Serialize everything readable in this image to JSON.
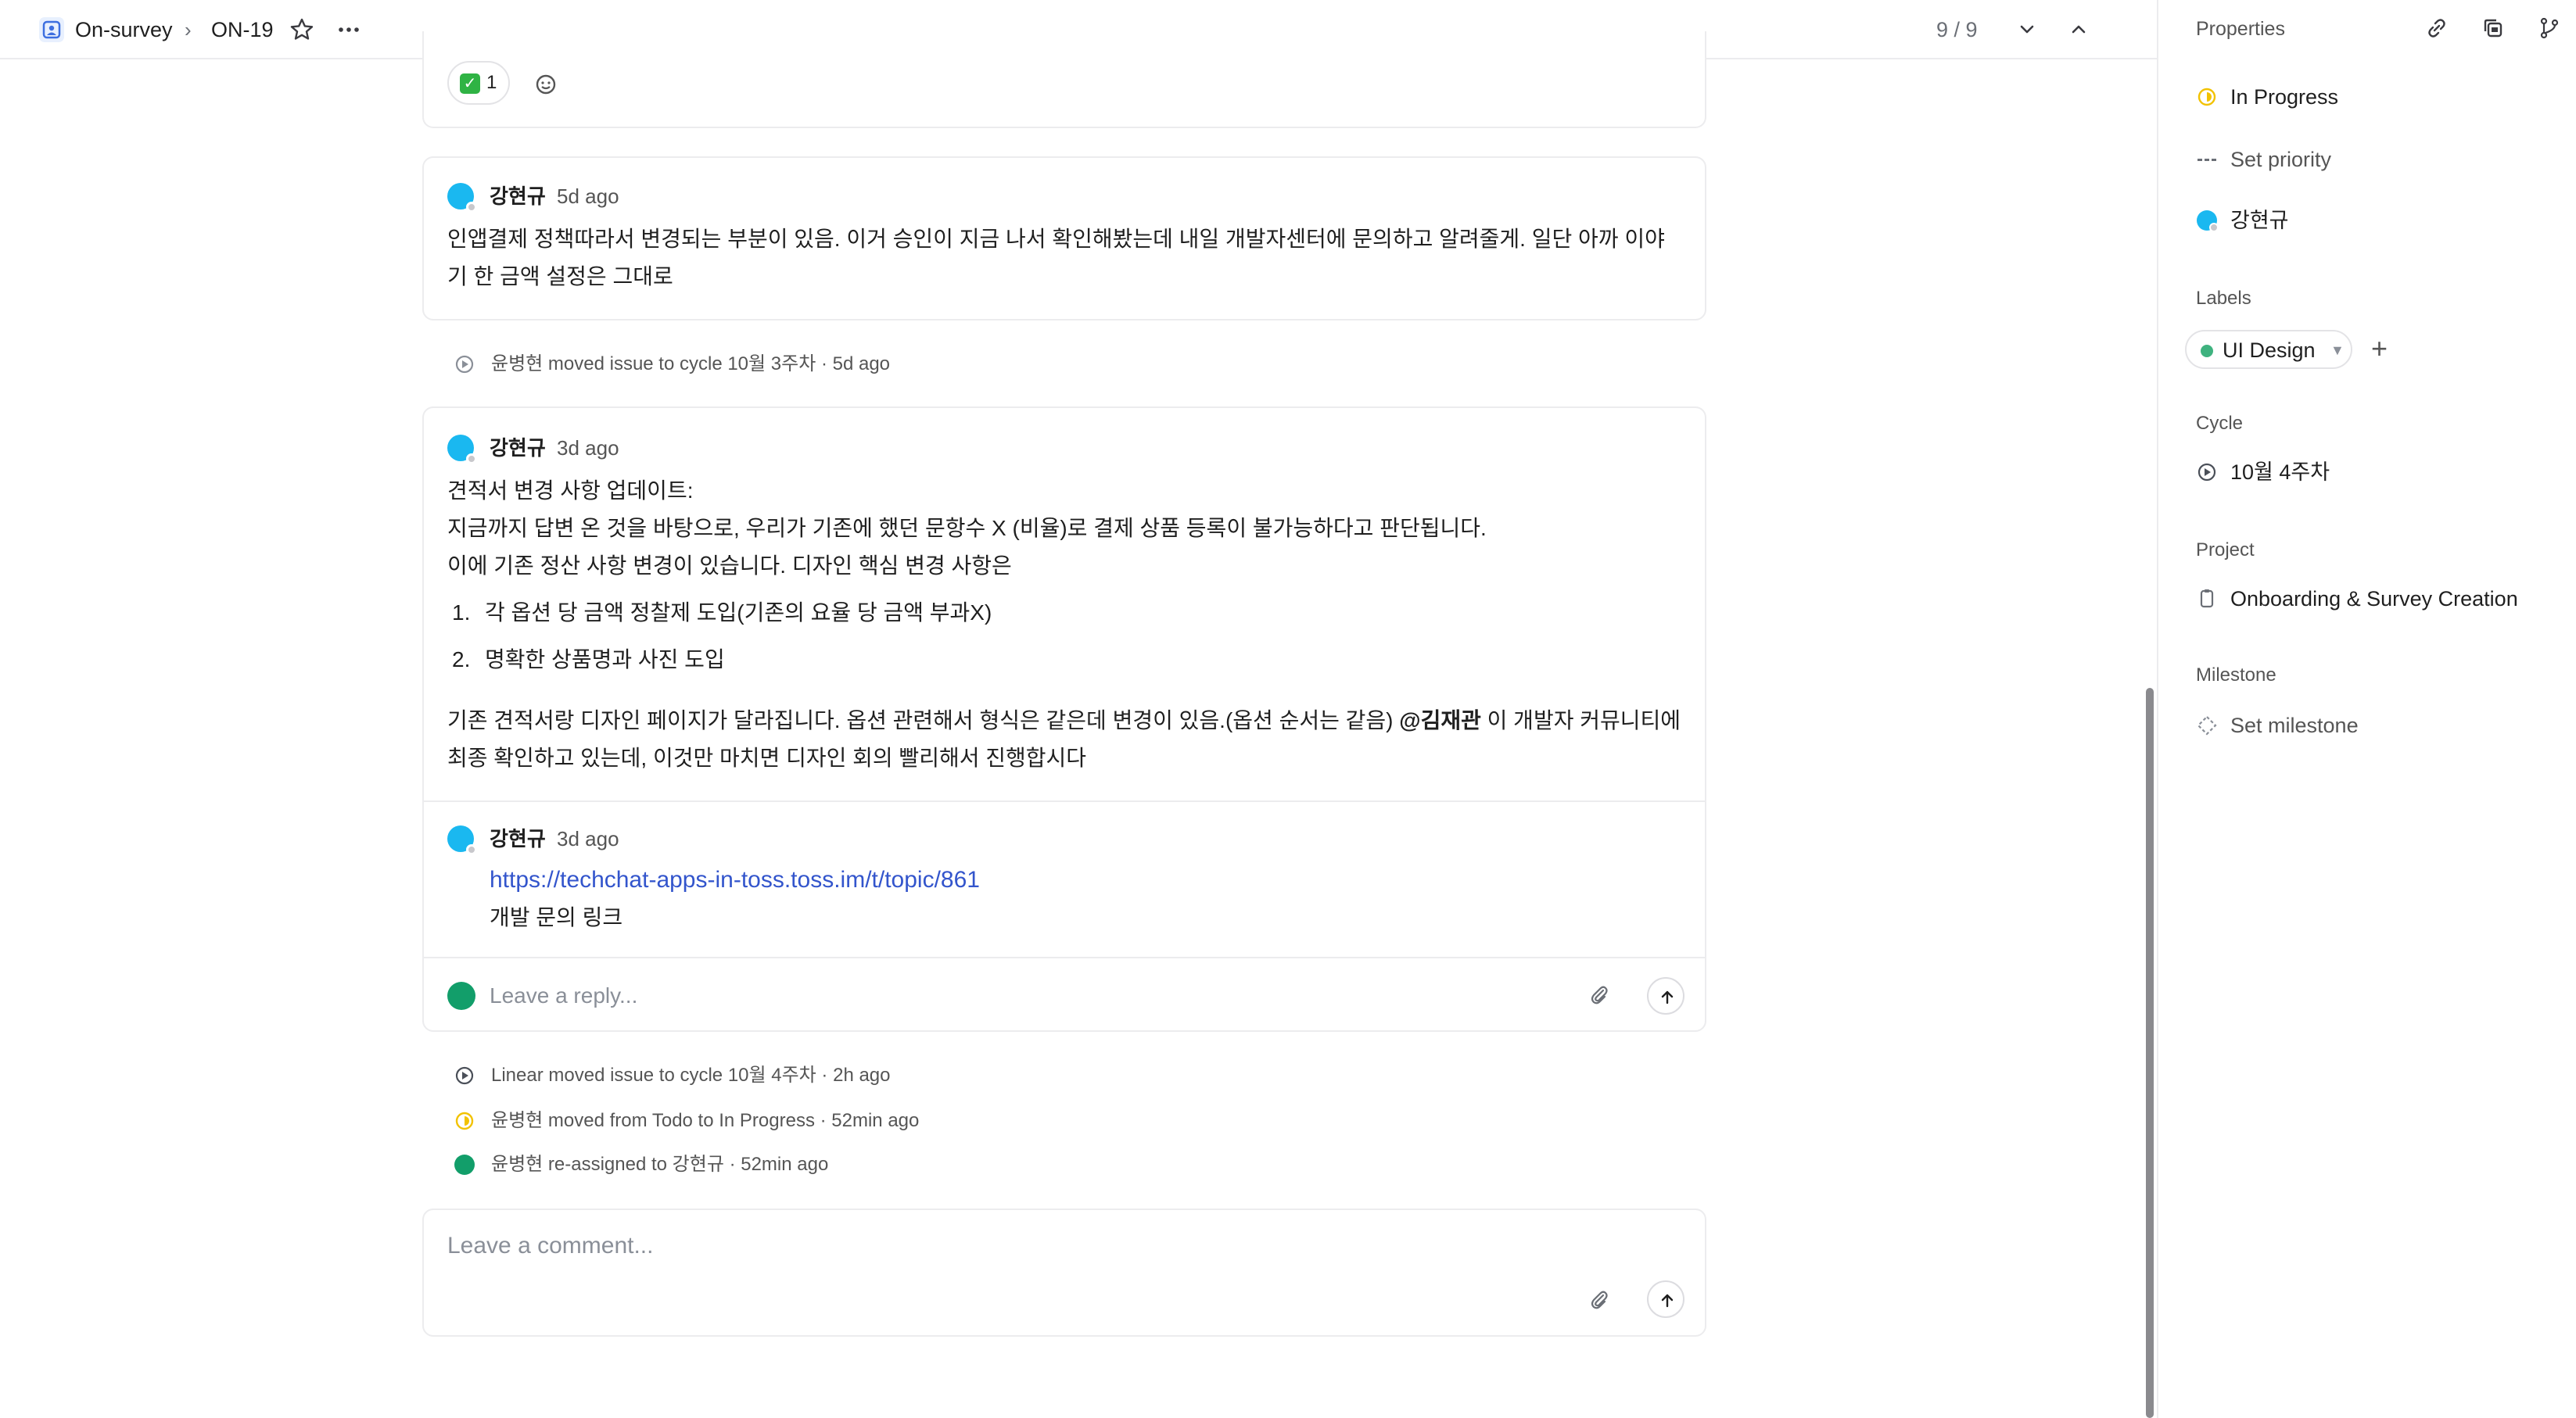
{
  "header": {
    "team": "On-survey",
    "separator": "›",
    "issue_id": "ON-19",
    "pager": "9 / 9"
  },
  "reaction": {
    "emoji": "✓",
    "count": "1"
  },
  "comments": [
    {
      "author": "강현규",
      "time": "5d ago",
      "text": "인앱결제 정책따라서 변경되는 부분이 있음. 이거 승인이 지금 나서 확인해봤는데 내일 개발자센터에 문의하고 알려줄게. 일단 아까 이야기 한 금액 설정은 그대로"
    },
    {
      "author": "강현규",
      "time": "3d ago",
      "line1": "견적서 변경 사항 업데이트:",
      "line2": "지금까지 답변 온 것을 바탕으로, 우리가 기존에 했던 문항수 X (비율)로 결제 상품 등록이 불가능하다고 판단됩니다.",
      "line3": "이에 기존 정산 사항 변경이 있습니다. 디자인 핵심 변경 사항은",
      "list": [
        {
          "num": "1.",
          "text": "각 옵션 당 금액 정찰제 도입(기존의 요율 당 금액 부과X)"
        },
        {
          "num": "2.",
          "text": "명확한 상품명과 사진 도입"
        }
      ],
      "para_before": "기존 견적서랑 디자인 페이지가 달라집니다. 옵션 관련해서 형식은 같은데 변경이 있음.(옵션 순서는 같음) ",
      "mention": "@김재관",
      "para_after": " 이 개발자 커뮤니티에 최종 확인하고 있는데, 이것만 마치면 디자인 회의 빨리해서 진행합시다"
    }
  ],
  "reply": {
    "author": "강현규",
    "time": "3d ago",
    "link": "https://techchat-apps-in-toss.toss.im/t/topic/861",
    "text": "개발 문의 링크",
    "placeholder": "Leave a reply..."
  },
  "activities": [
    {
      "text": "윤병현 moved issue to cycle 10월 3주차 · 5d ago"
    },
    {
      "text": "Linear moved issue to cycle 10월 4주차 · 2h ago"
    },
    {
      "text": "윤병현 moved from Todo to In Progress · 52min ago"
    },
    {
      "text": "윤병현 re-assigned to 강현규 · 52min ago"
    }
  ],
  "comment_box": {
    "placeholder": "Leave a comment..."
  },
  "sidebar": {
    "title": "Properties",
    "status": "In Progress",
    "priority": "Set priority",
    "assignee": "강현규",
    "labels_heading": "Labels",
    "label": "UI Design",
    "cycle_heading": "Cycle",
    "cycle": "10월 4주차",
    "project_heading": "Project",
    "project": "Onboarding & Survey Creation",
    "milestone_heading": "Milestone",
    "milestone": "Set milestone"
  },
  "colors": {
    "accent_blue": "#1ab8f0",
    "status_yellow": "#f2c200",
    "label_green": "#3fb27f",
    "link_blue": "#3355cc",
    "activity_green": "#129e6a"
  },
  "icons": [
    "team-icon",
    "star-icon",
    "more-icon",
    "chevron-down-icon",
    "chevron-up-icon",
    "link-icon",
    "copy-icon",
    "branch-icon",
    "emoji-add-icon",
    "cycle-icon",
    "attach-icon",
    "send-icon",
    "status-in-progress-icon",
    "priority-icon",
    "project-icon",
    "milestone-icon"
  ]
}
